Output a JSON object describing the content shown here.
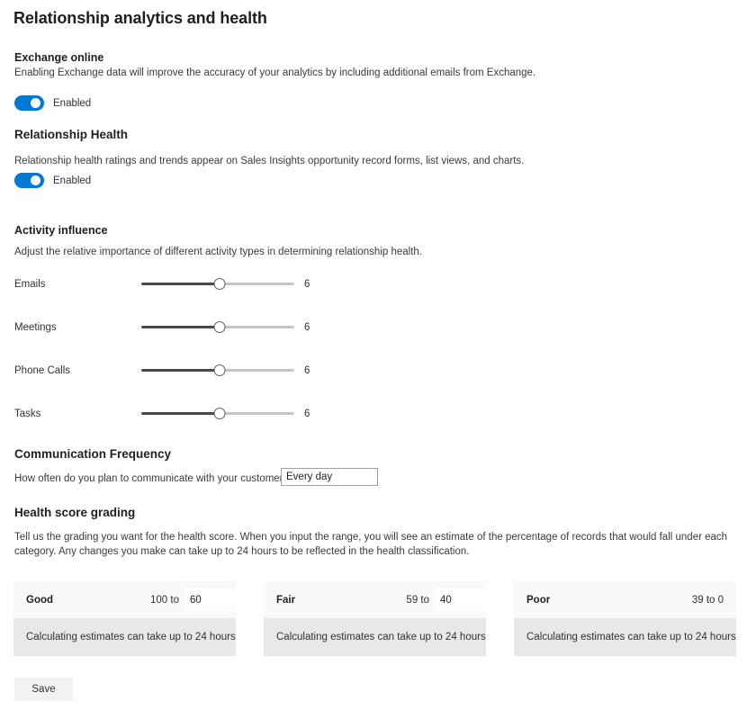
{
  "page": {
    "title": "Relationship analytics and health"
  },
  "exchange": {
    "heading": "Exchange online",
    "description": "Enabling Exchange data will improve the accuracy of your analytics by including additional emails from Exchange.",
    "toggle_label": "Enabled",
    "toggle_on": true
  },
  "relationship_health": {
    "heading": "Relationship Health",
    "description": "Relationship health ratings and trends appear on Sales Insights opportunity record forms, list views, and charts.",
    "toggle_label": "Enabled",
    "toggle_on": true
  },
  "activity_influence": {
    "heading": "Activity influence",
    "description": "Adjust the relative importance of different activity types in determining relationship health.",
    "sliders": [
      {
        "label": "Emails",
        "value": "6",
        "min": 0,
        "max": 10,
        "percent": 51
      },
      {
        "label": "Meetings",
        "value": "6",
        "min": 0,
        "max": 10,
        "percent": 51
      },
      {
        "label": "Phone Calls",
        "value": "6",
        "min": 0,
        "max": 10,
        "percent": 51
      },
      {
        "label": "Tasks",
        "value": "6",
        "min": 0,
        "max": 10,
        "percent": 51
      }
    ]
  },
  "communication_frequency": {
    "heading": "Communication Frequency",
    "question": "How often do you plan to communicate with your customers?*",
    "value": "Every day",
    "placeholder": ""
  },
  "health_score_grading": {
    "heading": "Health score grading",
    "description": "Tell us the grading you want for the health score. When you input the range, you will see an estimate of the percentage of records that would fall under each category. Any changes you make can take up to 24 hours to be reflected in the health classification.",
    "cards": [
      {
        "title": "Good",
        "range_prefix": "100 to",
        "range_value": "60",
        "editable": true,
        "estimate": "Calculating estimates can take up to 24 hours"
      },
      {
        "title": "Fair",
        "range_prefix": "59 to",
        "range_value": "40",
        "editable": true,
        "estimate": "Calculating estimates can take up to 24 hours"
      },
      {
        "title": "Poor",
        "range_prefix": "39 to 0",
        "range_value": "",
        "editable": false,
        "estimate": "Calculating estimates can take up to 24 hours"
      }
    ]
  },
  "footer": {
    "save_label": "Save"
  },
  "colors": {
    "accent": "#0078d4",
    "text": "#323130",
    "heading": "#201f1e",
    "card_header_bg": "#faf9f8",
    "card_body_bg": "#e9e8e7",
    "slider_track": "#c8c6c4",
    "slider_fill": "#4a4a4a",
    "button_bg": "#f3f2f1"
  }
}
